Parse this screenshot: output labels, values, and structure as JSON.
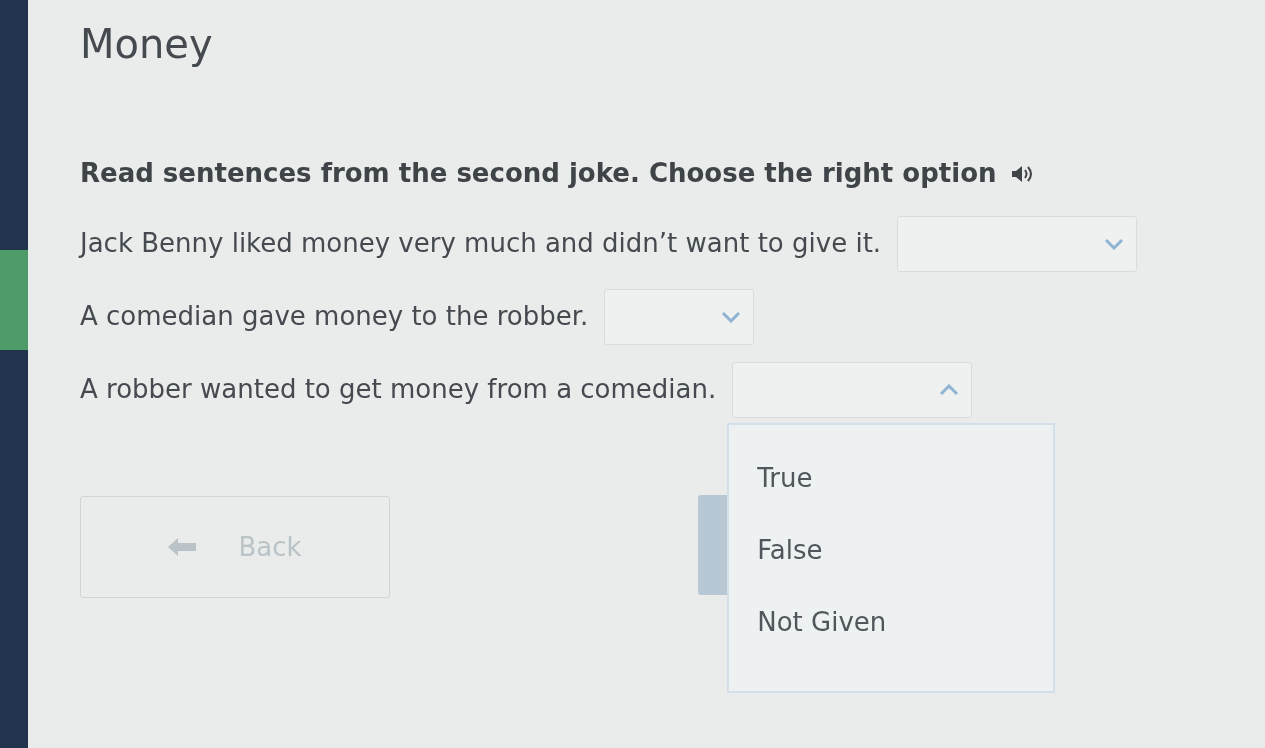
{
  "sidebar": {
    "sections": [
      {
        "selected": false
      },
      {
        "selected": true
      },
      {
        "selected": false
      }
    ]
  },
  "title": "Money",
  "instruction": "Read sentences from the second joke. Choose the right option",
  "questions": [
    {
      "text": "Jack Benny liked money very much and didn’t want to give it.",
      "expanded": false
    },
    {
      "text": "A comedian gave money to the robber.",
      "expanded": false
    },
    {
      "text": "A robber wanted to get money from a comedian.",
      "expanded": true,
      "options": [
        "True",
        "False",
        "Not Given"
      ]
    }
  ],
  "back_button": {
    "label": "Back",
    "disabled": true
  }
}
